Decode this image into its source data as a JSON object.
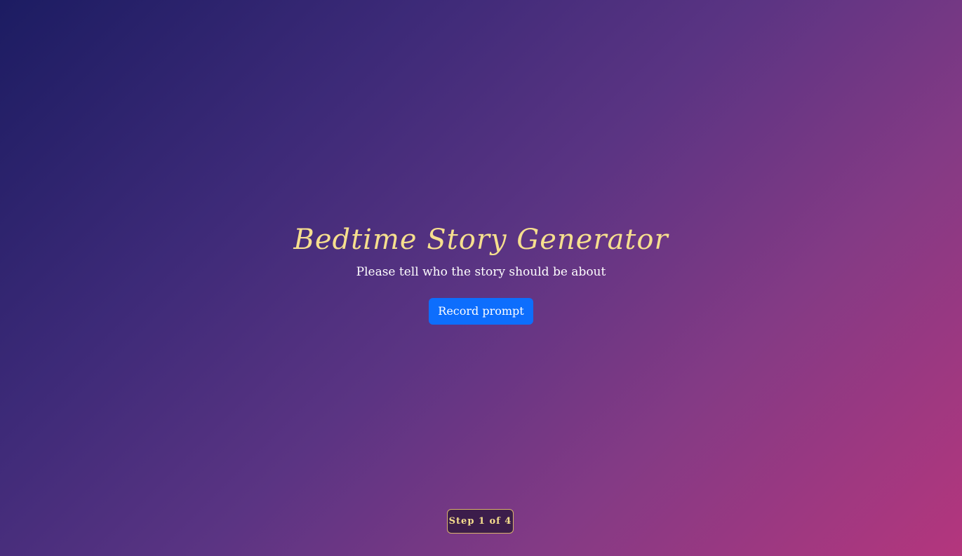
{
  "app": {
    "title": "Bedtime Story Generator",
    "subtitle": "Please tell who the story should be about"
  },
  "actions": {
    "record_label": "Record prompt"
  },
  "progress": {
    "label": "Step 1 of 4",
    "current_step": 1,
    "total_steps": 4
  },
  "colors": {
    "gradient_start": "#1c1c62",
    "gradient_end": "#b4367d",
    "title": "#f6df8e",
    "button": "#0d6efd",
    "step_badge_bg": "#3c1d4b",
    "step_badge_border": "#d9b46a"
  }
}
